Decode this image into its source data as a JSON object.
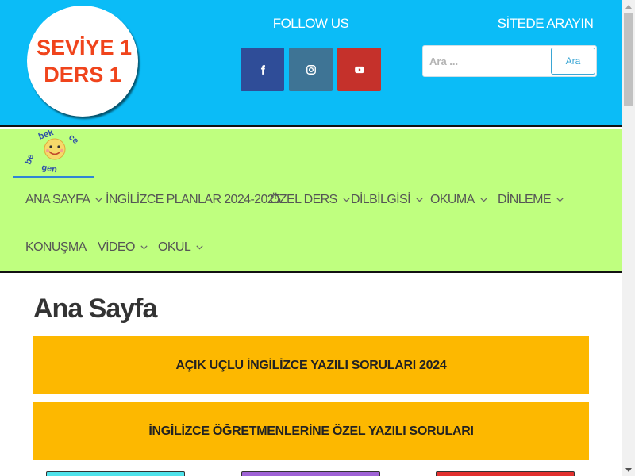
{
  "header": {
    "logo": {
      "line1": "SEVİYE 1",
      "line2": "DERS 1"
    },
    "follow_title": "FOLLOW US",
    "social": [
      {
        "name": "facebook",
        "icon": "facebook-icon",
        "color": "#2f4d98"
      },
      {
        "name": "instagram",
        "icon": "instagram-icon",
        "color": "#3e7495"
      },
      {
        "name": "youtube",
        "icon": "youtube-icon",
        "color": "#c5312b"
      }
    ],
    "search_title": "SİTEDE ARAYIN",
    "search_placeholder": "Ara ...",
    "search_button": "Ara"
  },
  "nav": {
    "items": [
      {
        "label": "ANA SAYFA",
        "has_submenu": true
      },
      {
        "label": "İNGİLİZCE PLANLAR 2024-2025",
        "has_submenu": false
      },
      {
        "label": "ÖZEL DERS",
        "has_submenu": true
      },
      {
        "label": "DİLBİLGİSİ",
        "has_submenu": true
      },
      {
        "label": "OKUMA",
        "has_submenu": true
      },
      {
        "label": "DİNLEME",
        "has_submenu": true
      },
      {
        "label": "KONUŞMA",
        "has_submenu": false
      },
      {
        "label": "VİDEO",
        "has_submenu": true
      },
      {
        "label": "OKUL",
        "has_submenu": true
      }
    ]
  },
  "main": {
    "title": "Ana Sayfa",
    "banners": [
      "AÇIK UÇLU İNGİLİZCE YAZILI SORULARI 2024",
      "İNGİLİZCE ÖĞRETMENLERİNE ÖZEL YAZILI SORULARI"
    ]
  },
  "colors": {
    "header_bg": "#0bbcf7",
    "nav_bg": "#bfff7f",
    "banner_bg": "#fdb800",
    "logo_text": "#f0441c"
  }
}
